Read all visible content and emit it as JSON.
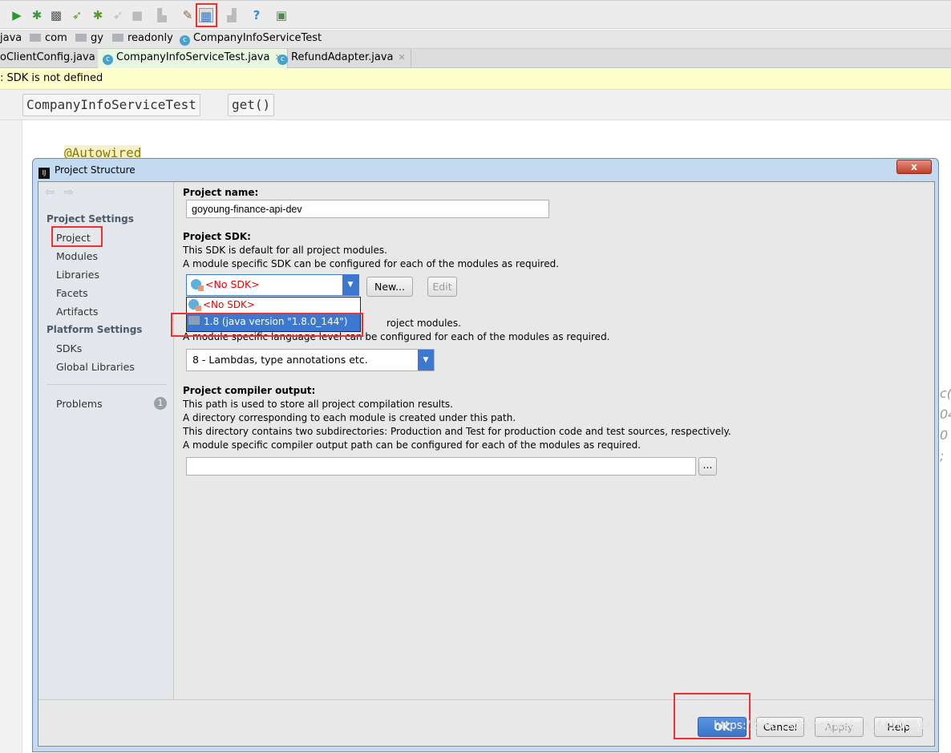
{
  "toolbar": {
    "icons": [
      "run-icon",
      "debug-icon",
      "coverage-icon",
      "run-jrebel-icon",
      "debug-jrebel-icon",
      "profile-icon",
      "stop-icon",
      "attach-icon",
      "settings-icon",
      "project-structure-icon",
      "sdk-icon",
      "help-icon",
      "jrebel-panel-icon"
    ]
  },
  "breadcrumb": [
    "java",
    "com",
    "gy",
    "readonly",
    "CompanyInfoServiceTest"
  ],
  "tabs": [
    {
      "label": "oClientConfig.java"
    },
    {
      "label": "CompanyInfoServiceTest.java",
      "active": true
    },
    {
      "label": "RefundAdapter.java"
    }
  ],
  "banner": ": SDK is not defined",
  "method_bar": [
    "CompanyInfoServiceTest",
    "get()"
  ],
  "editor": {
    "annotation": "@Autowired",
    "fragments": [
      "c(",
      "04",
      "0 ;"
    ]
  },
  "dialog": {
    "title": "Project Structure",
    "close": "x",
    "sidebar": {
      "project_settings": "Project Settings",
      "items": [
        "Project",
        "Modules",
        "Libraries",
        "Facets",
        "Artifacts"
      ],
      "platform_settings": "Platform Settings",
      "platform_items": [
        "SDKs",
        "Global Libraries"
      ],
      "problems": "Problems",
      "problems_count": "1"
    },
    "project_name_label": "Project name:",
    "project_name": "goyoung-finance-api-dev",
    "sdk_label": "Project SDK:",
    "sdk_desc1": "This SDK is default for all project modules.",
    "sdk_desc2": "A module specific SDK can be configured for each of the modules as required.",
    "sdk_selected": "<No SDK>",
    "new_button": "New...",
    "edit_button": "Edit",
    "sdk_options": [
      "<No SDK>",
      "1.8 (java version \"1.8.0_144\")"
    ],
    "lang_desc1_visible": "roject modules.",
    "lang_desc2": "A module specific language level can be configured for each of the modules as required.",
    "lang_level": "8 - Lambdas, type annotations etc.",
    "output_label": "Project compiler output:",
    "output_desc": [
      "This path is used to store all project compilation results.",
      "A directory corresponding to each module is created under this path.",
      "This directory contains two subdirectories: Production and Test for production code and test sources, respectively.",
      "A module specific compiler output path can be configured for each of the modules as required."
    ],
    "output_path": "",
    "browse": "...",
    "ok": "OK",
    "cancel": "Cancel",
    "apply": "Apply",
    "help": "Help"
  },
  "watermark": "https://blog.csdn.net/weixin_44100514",
  "colors": {
    "accent": "#3c78d0",
    "highlight_box": "#f03030",
    "banner": "#ffffcc"
  }
}
